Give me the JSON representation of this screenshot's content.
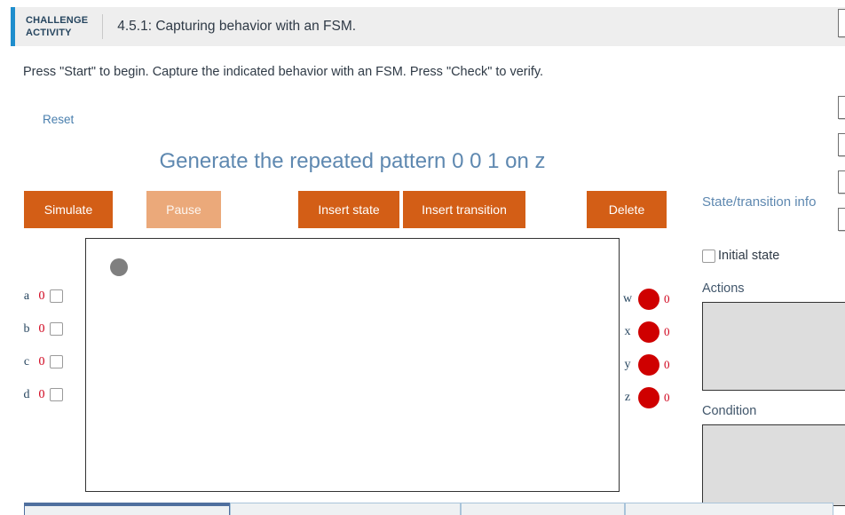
{
  "header": {
    "badge_line1": "CHALLENGE",
    "badge_line2": "ACTIVITY",
    "title": "4.5.1: Capturing behavior with an FSM.",
    "accent_color": "#1f8ecd",
    "background_color": "#eeeeee"
  },
  "instructions": "Press \"Start\" to begin. Capture the indicated behavior with an FSM. Press \"Check\" to verify.",
  "reset_label": "Reset",
  "simulator": {
    "title": "Generate the repeated pattern 0 0 1 on z",
    "title_color": "#5e88b0",
    "toolbar": {
      "simulate_label": "Simulate",
      "pause_label": "Pause",
      "insert_state_label": "Insert state",
      "insert_transition_label": "Insert transition",
      "delete_label": "Delete",
      "active_color": "#d35e16",
      "disabled_color": "#eba97a"
    },
    "inputs": [
      {
        "name": "a",
        "value": "0",
        "checked": false
      },
      {
        "name": "b",
        "value": "0",
        "checked": false
      },
      {
        "name": "c",
        "value": "0",
        "checked": false
      },
      {
        "name": "d",
        "value": "0",
        "checked": false
      }
    ],
    "outputs": [
      {
        "name": "w",
        "value": "0",
        "led_color": "#cf0000"
      },
      {
        "name": "x",
        "value": "0",
        "led_color": "#cf0000"
      },
      {
        "name": "y",
        "value": "0",
        "led_color": "#cf0000"
      },
      {
        "name": "z",
        "value": "0",
        "led_color": "#cf0000"
      }
    ],
    "canvas": {
      "states": [
        {
          "id": "s0",
          "label": "",
          "color": "#7f7f7f"
        }
      ]
    },
    "info_panel": {
      "heading": "State/transition info",
      "initial_state_label": "Initial state",
      "initial_state_checked": false,
      "actions_label": "Actions",
      "actions_value": "",
      "condition_label": "Condition",
      "condition_value": ""
    }
  },
  "tabs": [
    {
      "label": "",
      "active": true
    },
    {
      "label": "",
      "active": false
    },
    {
      "label": "",
      "active": false
    },
    {
      "label": "",
      "active": false
    }
  ]
}
